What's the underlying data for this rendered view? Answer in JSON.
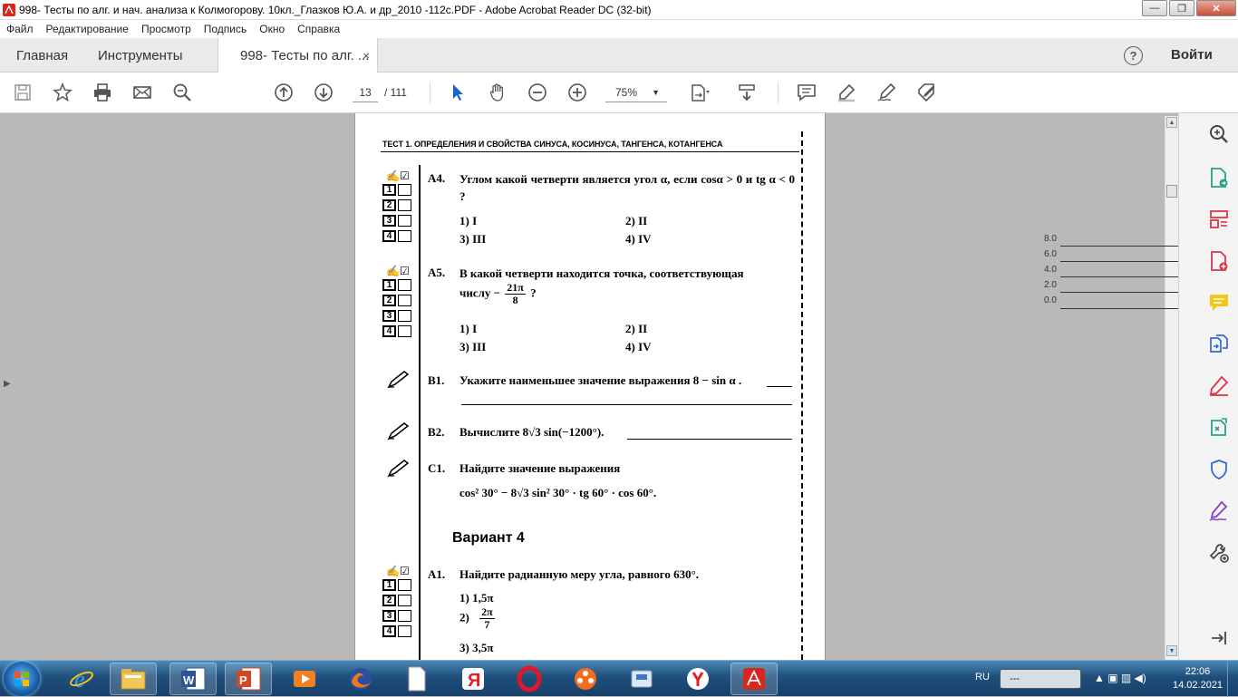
{
  "window": {
    "title": "998- Тесты по алг. и нач. анализа к Колмогорову. 10кл._Глазков Ю.А. и др_2010 -112с.PDF - Adobe Acrobat Reader DC (32-bit)",
    "minimize": "—",
    "maximize": "❐",
    "close": "✕"
  },
  "menu": [
    "Файл",
    "Редактирование",
    "Просмотр",
    "Подпись",
    "Окно",
    "Справка"
  ],
  "tabs": {
    "home": "Главная",
    "tools": "Инструменты",
    "doc": "998- Тесты по алг. ...",
    "close": "×",
    "help": "?",
    "login": "Войти"
  },
  "toolbar": {
    "page_current": "13",
    "page_total": "/ 111",
    "zoom": "75%"
  },
  "minichart": {
    "labels": [
      "8.0",
      "6.0",
      "4.0",
      "2.0",
      "0.0"
    ]
  },
  "pdf": {
    "header": "ТЕСТ 1. ОПРЕДЕЛЕНИЯ И СВОЙСТВА СИНУСА, КОСИНУСА, ТАНГЕНСА, КОТАНГЕНСА",
    "answer_digits": [
      "1",
      "2",
      "3",
      "4"
    ],
    "a4": {
      "label": "А4.",
      "text": "Углом какой четверти является угол α, если cosα > 0 и tg α < 0 ?",
      "options": [
        "1)  I",
        "2)  II",
        "3)  III",
        "4)  IV"
      ]
    },
    "a5": {
      "label": "А5.",
      "text": "В какой четверти находится точка, соответствующая",
      "text2_pre": "числу −",
      "frac_num": "21π",
      "frac_den": "8",
      "text2_post": " ?",
      "options": [
        "1)  I",
        "2)  II",
        "3)  III",
        "4)  IV"
      ]
    },
    "b1": {
      "label": "В1.",
      "text": "Укажите наименьшее значение выражения  8 − sin α ."
    },
    "b2": {
      "label": "В2.",
      "text": "Вычислите  8√3 sin(−1200°)."
    },
    "c1": {
      "label": "С1.",
      "text": "Найдите значение выражения",
      "expr": "cos² 30° − 8√3 sin² 30° · tg 60° · cos 60°."
    },
    "variant": "Вариант 4",
    "v4a1": {
      "label": "А1.",
      "text": "Найдите радианную меру угла, равного 630°.",
      "opt1": "1)  1,5π",
      "opt2_pre": "2)",
      "opt2_num": "2π",
      "opt2_den": "7",
      "opt3": "3)  3,5π"
    }
  },
  "taskbar": {
    "lang": "RU",
    "box": "---",
    "time": "22:06",
    "date": "14.02.2021"
  }
}
